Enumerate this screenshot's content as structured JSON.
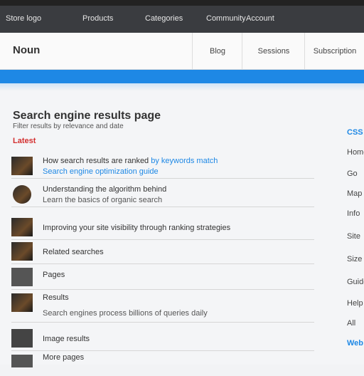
{
  "topbar": {
    "items": [
      "Store logo",
      "Products",
      "Categories",
      "Community",
      "Account"
    ]
  },
  "header": {
    "logo": "Noun",
    "nav": [
      "Blog",
      "Sessions",
      "Subscription"
    ]
  },
  "article": {
    "title": "Search engine results page",
    "subtitle": "Filter results by relevance and date",
    "tag": "Latest"
  },
  "results": [
    {
      "line1": "How search results are ranked",
      "line1_link": " by keywords match",
      "line2": "Search engine optimization guide",
      "line2_link": true
    },
    {
      "line1": "Understanding the algorithm behind",
      "line2": "Learn the basics of organic search"
    },
    {
      "line1": "Improving your site visibility through ranking strategies",
      "line2": ""
    },
    {
      "line1": "Related searches",
      "line2": ""
    },
    {
      "line1": "Pages",
      "line2": ""
    },
    {
      "line1": "Results",
      "line2": "Search engines process billions of queries daily"
    },
    {
      "line1": "Image results",
      "line2": ""
    },
    {
      "line1": "More pages",
      "line2": ""
    }
  ],
  "sidebar": {
    "items": [
      "CSS",
      "Home",
      "Go",
      "Map",
      "Info",
      "Site",
      "Size",
      "Guide",
      "Help",
      "All",
      "Web"
    ]
  }
}
